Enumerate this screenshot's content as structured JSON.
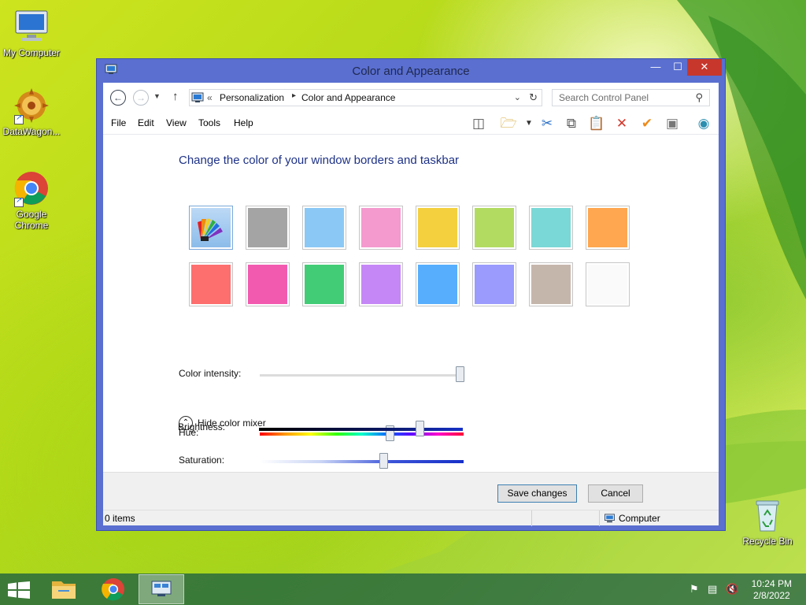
{
  "desktop": {
    "icons": [
      {
        "label": "My Computer"
      },
      {
        "label": "DataWagon..."
      },
      {
        "label": "Google Chrome"
      },
      {
        "label": "Recycle Bin"
      }
    ]
  },
  "window": {
    "title": "Color and Appearance",
    "controls": {
      "minimize": "—",
      "maximize": "☐",
      "close": "✕"
    }
  },
  "address": {
    "separator": "«",
    "breadcrumbs": [
      "Personalization",
      "Color and Appearance"
    ],
    "search_placeholder": "Search Control Panel"
  },
  "menu": [
    "File",
    "Edit",
    "View",
    "Tools",
    "Help"
  ],
  "toolbar_icons": [
    "pane-toggle-icon",
    "folder-check-icon",
    "cut-icon",
    "copy-icon",
    "paste-icon",
    "delete-icon",
    "check-icon",
    "properties-icon",
    "globe-icon"
  ],
  "content": {
    "heading": "Change the color of your window borders and taskbar",
    "swatches_row1": [
      "automatic",
      "#a4a4a4",
      "#8bc8f6",
      "#f49acf",
      "#f4d03f",
      "#b2db62",
      "#7ad8d6",
      "#fea750"
    ],
    "swatches_row2": [
      "#fd6e6e",
      "#f25aaf",
      "#43cc76",
      "#c587f6",
      "#57aefc",
      "#9a9bfd",
      "#c5b6ab",
      "#fafafa"
    ],
    "color_intensity_label": "Color intensity:",
    "color_intensity_value": 1.0,
    "mixer_toggle": "Hide color mixer",
    "hue_label": "Hue:",
    "hue_value": 0.64,
    "saturation_label": "Saturation:",
    "saturation_value": 0.61,
    "brightness_label": "Brightness:",
    "brightness_value": 0.79
  },
  "footer": {
    "save": "Save changes",
    "cancel": "Cancel"
  },
  "status": {
    "items": "0 items",
    "location": "Computer"
  },
  "taskbar": {
    "time": "10:24 PM",
    "date": "2/8/2022"
  }
}
